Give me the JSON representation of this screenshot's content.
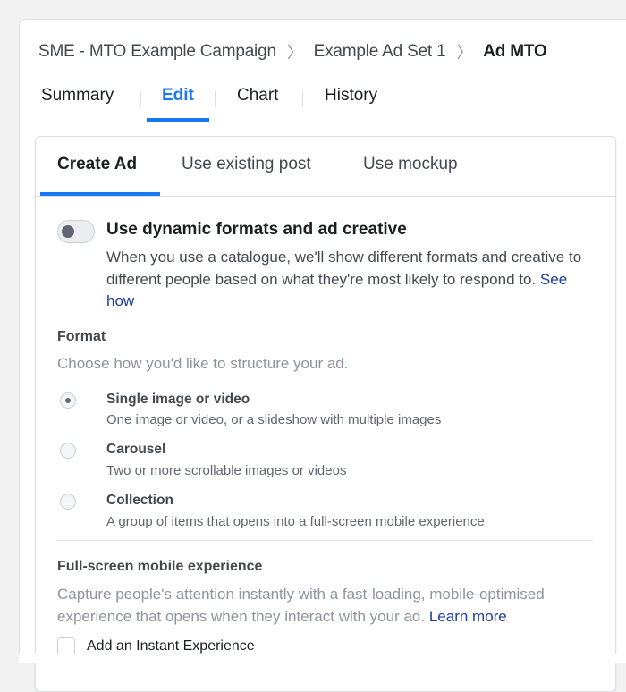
{
  "breadcrumb": {
    "items": [
      "SME - MTO Example Campaign",
      "Example Ad Set 1"
    ],
    "current": "Ad MTO",
    "separator": "〉"
  },
  "top_tabs": [
    {
      "label": "Summary",
      "active": false
    },
    {
      "label": "Edit",
      "active": true
    },
    {
      "label": "Chart",
      "active": false
    },
    {
      "label": "History",
      "active": false
    }
  ],
  "card_tabs": [
    {
      "label": "Create Ad",
      "active": true
    },
    {
      "label": "Use existing post",
      "active": false
    },
    {
      "label": "Use mockup",
      "active": false
    }
  ],
  "dynamic": {
    "toggle_on": false,
    "title": "Use dynamic formats and ad creative",
    "description": "When you use a catalogue, we'll show different formats and creative to different people based on what they're most likely to respond to.",
    "link": "See how"
  },
  "format": {
    "label": "Format",
    "subtitle": "Choose how you'd like to structure your ad.",
    "options": [
      {
        "title": "Single image or video",
        "description": "One image or video, or a slideshow with multiple images",
        "selected": true
      },
      {
        "title": "Carousel",
        "description": "Two or more scrollable images or videos",
        "selected": false
      },
      {
        "title": "Collection",
        "description": "A group of items that opens into a full-screen mobile experience",
        "selected": false
      }
    ]
  },
  "fullscreen": {
    "label": "Full-screen mobile experience",
    "description": "Capture people's attention instantly with a fast-loading, mobile-optimised experience that opens when they interact with your ad.",
    "link": "Learn more",
    "checkbox_label": "Add an Instant Experience",
    "checkbox_checked": false
  },
  "colors": {
    "accent": "#1877f2",
    "link": "#1d3f9c"
  }
}
